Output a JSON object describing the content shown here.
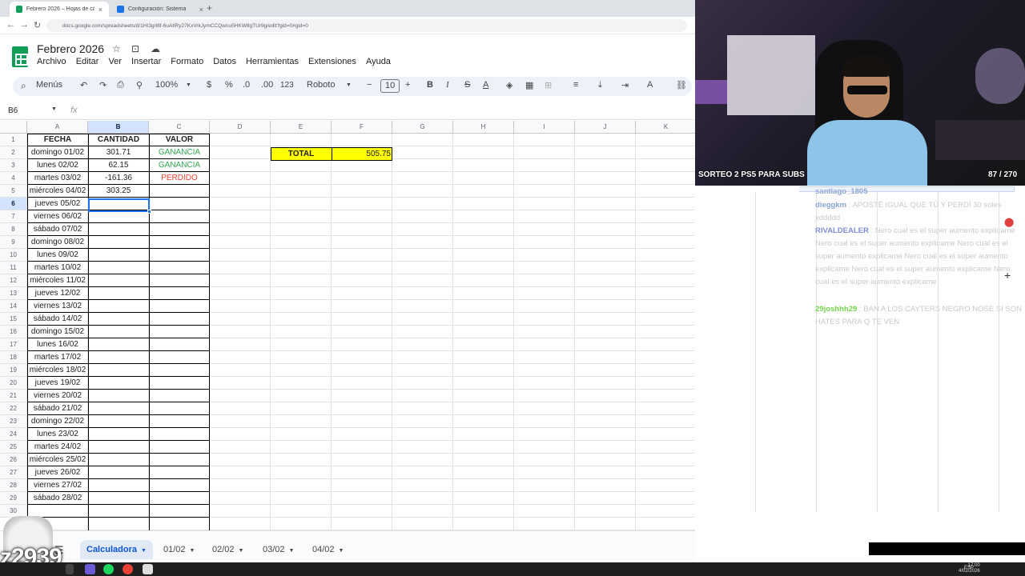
{
  "browser": {
    "tabs": [
      {
        "label": "Febrero 2026 – Hojas de cálcul",
        "active": true,
        "color": "#0f9d58"
      },
      {
        "label": "Configuración: Sistema",
        "active": false,
        "color": "#1a73e8"
      }
    ],
    "url": "docs.google.com/spreadsheets/d/1HI3grl8f-6uAIlRy27KxVrkJymCCQwnu5HKW8gTUr9g/edit?gid=0#gid=0"
  },
  "doc": {
    "title": "Febrero 2026",
    "menu": [
      "Archivo",
      "Editar",
      "Ver",
      "Insertar",
      "Formato",
      "Datos",
      "Herramientas",
      "Extensiones",
      "Ayuda"
    ]
  },
  "toolbar": {
    "search": "Menús",
    "zoom": "100%",
    "currency": "$",
    "percent": "%",
    "dec_less": ".0",
    "dec_more": ".00",
    "number_format": "123",
    "font": "Roboto",
    "font_size": "10",
    "bold": "B",
    "italic": "I",
    "strike": "S",
    "text_color": "A"
  },
  "formula_bar": {
    "name_box": "B6",
    "fx": "fx",
    "value": ""
  },
  "columns": [
    "A",
    "B",
    "C",
    "D",
    "E",
    "F",
    "G",
    "H",
    "I",
    "J",
    "K"
  ],
  "selected": {
    "column": "B",
    "row": 6
  },
  "table": {
    "headers": [
      "FECHA",
      "CANTIDAD",
      "VALOR"
    ],
    "rows": [
      {
        "date": "domingo 01/02",
        "amount": "301.71",
        "value": "GANANCIA",
        "status": "gain"
      },
      {
        "date": "lunes 02/02",
        "amount": "62.15",
        "value": "GANANCIA",
        "status": "gain"
      },
      {
        "date": "martes 03/02",
        "amount": "-161.36",
        "value": "PERDIDO",
        "status": "loss"
      },
      {
        "date": "miércoles 04/02",
        "amount": "303.25",
        "value": "",
        "status": ""
      },
      {
        "date": "jueves 05/02",
        "amount": "",
        "value": "",
        "status": ""
      },
      {
        "date": "viernes 06/02",
        "amount": "",
        "value": "",
        "status": ""
      },
      {
        "date": "sábado 07/02",
        "amount": "",
        "value": "",
        "status": ""
      },
      {
        "date": "domingo 08/02",
        "amount": "",
        "value": "",
        "status": ""
      },
      {
        "date": "lunes 09/02",
        "amount": "",
        "value": "",
        "status": ""
      },
      {
        "date": "martes 10/02",
        "amount": "",
        "value": "",
        "status": ""
      },
      {
        "date": "miércoles 11/02",
        "amount": "",
        "value": "",
        "status": ""
      },
      {
        "date": "jueves 12/02",
        "amount": "",
        "value": "",
        "status": ""
      },
      {
        "date": "viernes 13/02",
        "amount": "",
        "value": "",
        "status": ""
      },
      {
        "date": "sábado 14/02",
        "amount": "",
        "value": "",
        "status": ""
      },
      {
        "date": "domingo 15/02",
        "amount": "",
        "value": "",
        "status": ""
      },
      {
        "date": "lunes 16/02",
        "amount": "",
        "value": "",
        "status": ""
      },
      {
        "date": "martes 17/02",
        "amount": "",
        "value": "",
        "status": ""
      },
      {
        "date": "miércoles 18/02",
        "amount": "",
        "value": "",
        "status": ""
      },
      {
        "date": "jueves 19/02",
        "amount": "",
        "value": "",
        "status": ""
      },
      {
        "date": "viernes 20/02",
        "amount": "",
        "value": "",
        "status": ""
      },
      {
        "date": "sábado 21/02",
        "amount": "",
        "value": "",
        "status": ""
      },
      {
        "date": "domingo 22/02",
        "amount": "",
        "value": "",
        "status": ""
      },
      {
        "date": "lunes 23/02",
        "amount": "",
        "value": "",
        "status": ""
      },
      {
        "date": "martes 24/02",
        "amount": "",
        "value": "",
        "status": ""
      },
      {
        "date": "miércoles 25/02",
        "amount": "",
        "value": "",
        "status": ""
      },
      {
        "date": "jueves 26/02",
        "amount": "",
        "value": "",
        "status": ""
      },
      {
        "date": "viernes 27/02",
        "amount": "",
        "value": "",
        "status": ""
      },
      {
        "date": "sábado 28/02",
        "amount": "",
        "value": "",
        "status": ""
      }
    ]
  },
  "total": {
    "label": "TOTAL",
    "value": "505.75"
  },
  "sheets": [
    {
      "name": "Calculadora",
      "active": true
    },
    {
      "name": "01/02",
      "active": false
    },
    {
      "name": "02/02",
      "active": false
    },
    {
      "name": "03/02",
      "active": false
    },
    {
      "name": "04/02",
      "active": false
    }
  ],
  "stream": {
    "banner": "SORTEO 2 PS5 PARA SUBS",
    "subs_progress": {
      "current": 87,
      "goal": 270
    },
    "counter_text": "87 / 270",
    "chat": [
      {
        "user": "santiago_1805",
        "message": ""
      },
      {
        "user": "dieggkm",
        "message": "APOSTÉ IGUAL QUE TÚ Y PERDÍ 30 soles xddddd"
      },
      {
        "user": "RIVALDEALER",
        "message": "Nero cual es el super aumento explicame Nero cual es el super aumento explicame Nero cual es el super aumento explicame Nero cual es el super aumento explicame Nero cual es el super aumento explicame Nero cual es el super aumento explicame"
      },
      {
        "user": "29joshhh29",
        "message": "BAN A LOS CAYTERS NEGRO NOSE SI SON HATES PARA Q TE VEN"
      }
    ],
    "overlay_code": "z2939"
  },
  "taskbar": {
    "time": "17:00",
    "date": "4/02/2026",
    "lang": "ESP"
  }
}
